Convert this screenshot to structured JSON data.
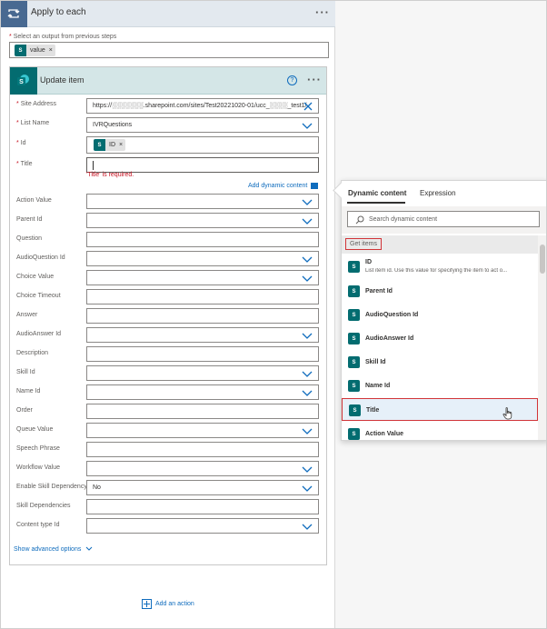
{
  "apply_to_each": {
    "title": "Apply to each",
    "select_label": "Select an output from previous steps",
    "token_value": "value",
    "token_remove": "×"
  },
  "update_item": {
    "title": "Update item",
    "help": "?",
    "fields": {
      "site_address": {
        "label": "Site Address",
        "value": "https://░░░░░░░.sharepoint.com/sites/Test20221020-01/ucc_░░░░_test1/"
      },
      "list_name": {
        "label": "List Name",
        "value": "IVRQuestions"
      },
      "id": {
        "label": "Id",
        "token": "ID",
        "token_remove": "×"
      },
      "title": {
        "label": "Title",
        "error": "'Title' is required."
      }
    },
    "add_dynamic_content": "Add dynamic content",
    "optional_fields": [
      "Action Value",
      "Parent Id",
      "Question",
      "AudioQuestion Id",
      "Choice Value",
      "Choice Timeout",
      "Answer",
      "AudioAnswer Id",
      "Description",
      "Skill Id",
      "Name Id",
      "Order",
      "Queue Value",
      "Speech Phrase",
      "Workflow Value",
      "Enable Skill Dependency",
      "Skill Dependencies",
      "Content type Id"
    ],
    "enable_skill_dependency_value": "No",
    "show_advanced_options": "Show advanced options"
  },
  "add_action": "Add an action",
  "dynamic_panel": {
    "tabs": [
      "Dynamic content",
      "Expression"
    ],
    "search_placeholder": "Search dynamic content",
    "section": "Get items",
    "items": [
      {
        "name": "ID",
        "description": "List item id. Use this value for specifying the item to act o..."
      },
      {
        "name": "Parent Id"
      },
      {
        "name": "AudioQuestion Id"
      },
      {
        "name": "AudioAnswer Id"
      },
      {
        "name": "Skill Id"
      },
      {
        "name": "Name Id"
      },
      {
        "name": "Title"
      },
      {
        "name": "Action Value"
      }
    ]
  },
  "colors": {
    "sharepoint_teal": "#036c70",
    "loop_blue": "#486991",
    "link_blue": "#0f6cbd",
    "error_red": "#c50f1f",
    "highlight_red": "#d13438"
  }
}
